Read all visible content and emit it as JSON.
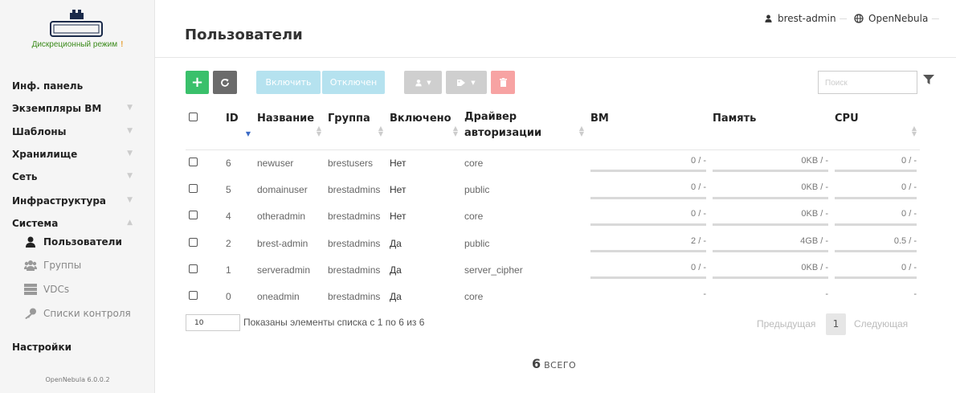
{
  "sidebar": {
    "mode_label": "Дискреционный режим",
    "mode_mark": "!",
    "items": [
      {
        "label": "Инф. панель"
      },
      {
        "label": "Экземпляры ВМ"
      },
      {
        "label": "Шаблоны"
      },
      {
        "label": "Хранилище"
      },
      {
        "label": "Сеть"
      },
      {
        "label": "Инфраструктура"
      },
      {
        "label": "Система"
      },
      {
        "label": "Настройки"
      }
    ],
    "system_children": [
      {
        "label": "Пользователи",
        "icon": "user-icon",
        "active": true
      },
      {
        "label": "Группы",
        "icon": "users-icon"
      },
      {
        "label": "VDCs",
        "icon": "server-icon"
      },
      {
        "label": "Списки контроля",
        "icon": "key-icon"
      }
    ],
    "version": "OpenNebula 6.0.0.2"
  },
  "header": {
    "title": "Пользователи",
    "user": "brest-admin",
    "zone": "OpenNebula"
  },
  "toolbar": {
    "add": "+",
    "enable_label": "Включить",
    "disable_label": "Отключен",
    "search_placeholder": "Поиск"
  },
  "table": {
    "columns": [
      "ID",
      "Название",
      "Группа",
      "Включено",
      "Драйвер авторизации",
      "ВМ",
      "Память",
      "CPU"
    ],
    "rows": [
      {
        "id": "6",
        "name": "newuser",
        "group": "brestusers",
        "enabled": "Нет",
        "driver": "core",
        "vm": "0 / -",
        "mem": "0KB / -",
        "cpu": "0 / -"
      },
      {
        "id": "5",
        "name": "domainuser",
        "group": "brestadmins",
        "enabled": "Нет",
        "driver": "public",
        "vm": "0 / -",
        "mem": "0KB / -",
        "cpu": "0 / -"
      },
      {
        "id": "4",
        "name": "otheradmin",
        "group": "brestadmins",
        "enabled": "Нет",
        "driver": "core",
        "vm": "0 / -",
        "mem": "0KB / -",
        "cpu": "0 / -"
      },
      {
        "id": "2",
        "name": "brest-admin",
        "group": "brestadmins",
        "enabled": "Да",
        "driver": "public",
        "vm": "2 / -",
        "mem": "4GB / -",
        "cpu": "0.5 / -"
      },
      {
        "id": "1",
        "name": "serveradmin",
        "group": "brestadmins",
        "enabled": "Да",
        "driver": "server_cipher",
        "vm": "0 / -",
        "mem": "0KB / -",
        "cpu": "0 / -"
      },
      {
        "id": "0",
        "name": "oneadmin",
        "group": "brestadmins",
        "enabled": "Да",
        "driver": "core",
        "vm": "-",
        "mem": "-",
        "cpu": "-"
      }
    ]
  },
  "footer": {
    "page_length": "10",
    "info": "Показаны элементы списка с 1 по 6 из 6",
    "prev": "Предыдущая",
    "page": "1",
    "next": "Следующая",
    "total_count": "6",
    "total_label": "ВСЕГО"
  },
  "colors": {
    "add": "#3ac06b",
    "delete": "#f7a3a3",
    "enable": "#b5e2ef",
    "mode": "#3a8a1a"
  }
}
